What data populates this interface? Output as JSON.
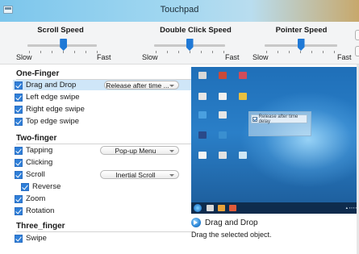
{
  "window": {
    "title": "Touchpad"
  },
  "speed_sliders": [
    {
      "title": "Scroll Speed",
      "min_label": "Slow",
      "max_label": "Fast",
      "value_fraction": 0.52
    },
    {
      "title": "Double Click Speed",
      "min_label": "Slow",
      "max_label": "Fast",
      "value_fraction": 0.5
    },
    {
      "title": "Pointer Speed",
      "min_label": "Slow",
      "max_label": "Fast",
      "value_fraction": 0.5
    }
  ],
  "sections": {
    "one_finger": {
      "header": "One-Finger",
      "drag_and_drop": {
        "label": "Drag and Drop",
        "checked": true,
        "dropdown": "Release after time ..."
      },
      "left_edge_swipe": {
        "label": "Left edge swipe",
        "checked": true
      },
      "right_edge_swipe": {
        "label": "Right edge swipe",
        "checked": true
      },
      "top_edge_swipe": {
        "label": "Top edge swipe",
        "checked": true
      }
    },
    "two_finger": {
      "header": "Two-finger",
      "tapping": {
        "label": "Tapping",
        "checked": true,
        "dropdown": "Pop-up Menu"
      },
      "clicking": {
        "label": "Clicking",
        "checked": true
      },
      "scroll": {
        "label": "Scroll",
        "checked": true,
        "dropdown": "Inertial Scroll"
      },
      "reverse": {
        "label": "Reverse",
        "checked": true
      },
      "zoom": {
        "label": "Zoom",
        "checked": true
      },
      "rotation": {
        "label": "Rotation",
        "checked": true
      }
    },
    "three_finger": {
      "header": "Three_finger",
      "swipe": {
        "label": "Swipe",
        "checked": true
      }
    }
  },
  "preview": {
    "window_option": "Release after time delay"
  },
  "description": {
    "title": "Drag and Drop",
    "text": "Drag the selected object."
  },
  "colors": {
    "accent": "#2f7fd8",
    "selection": "#cfe6f8",
    "title_bar": "#8fd0f0"
  }
}
